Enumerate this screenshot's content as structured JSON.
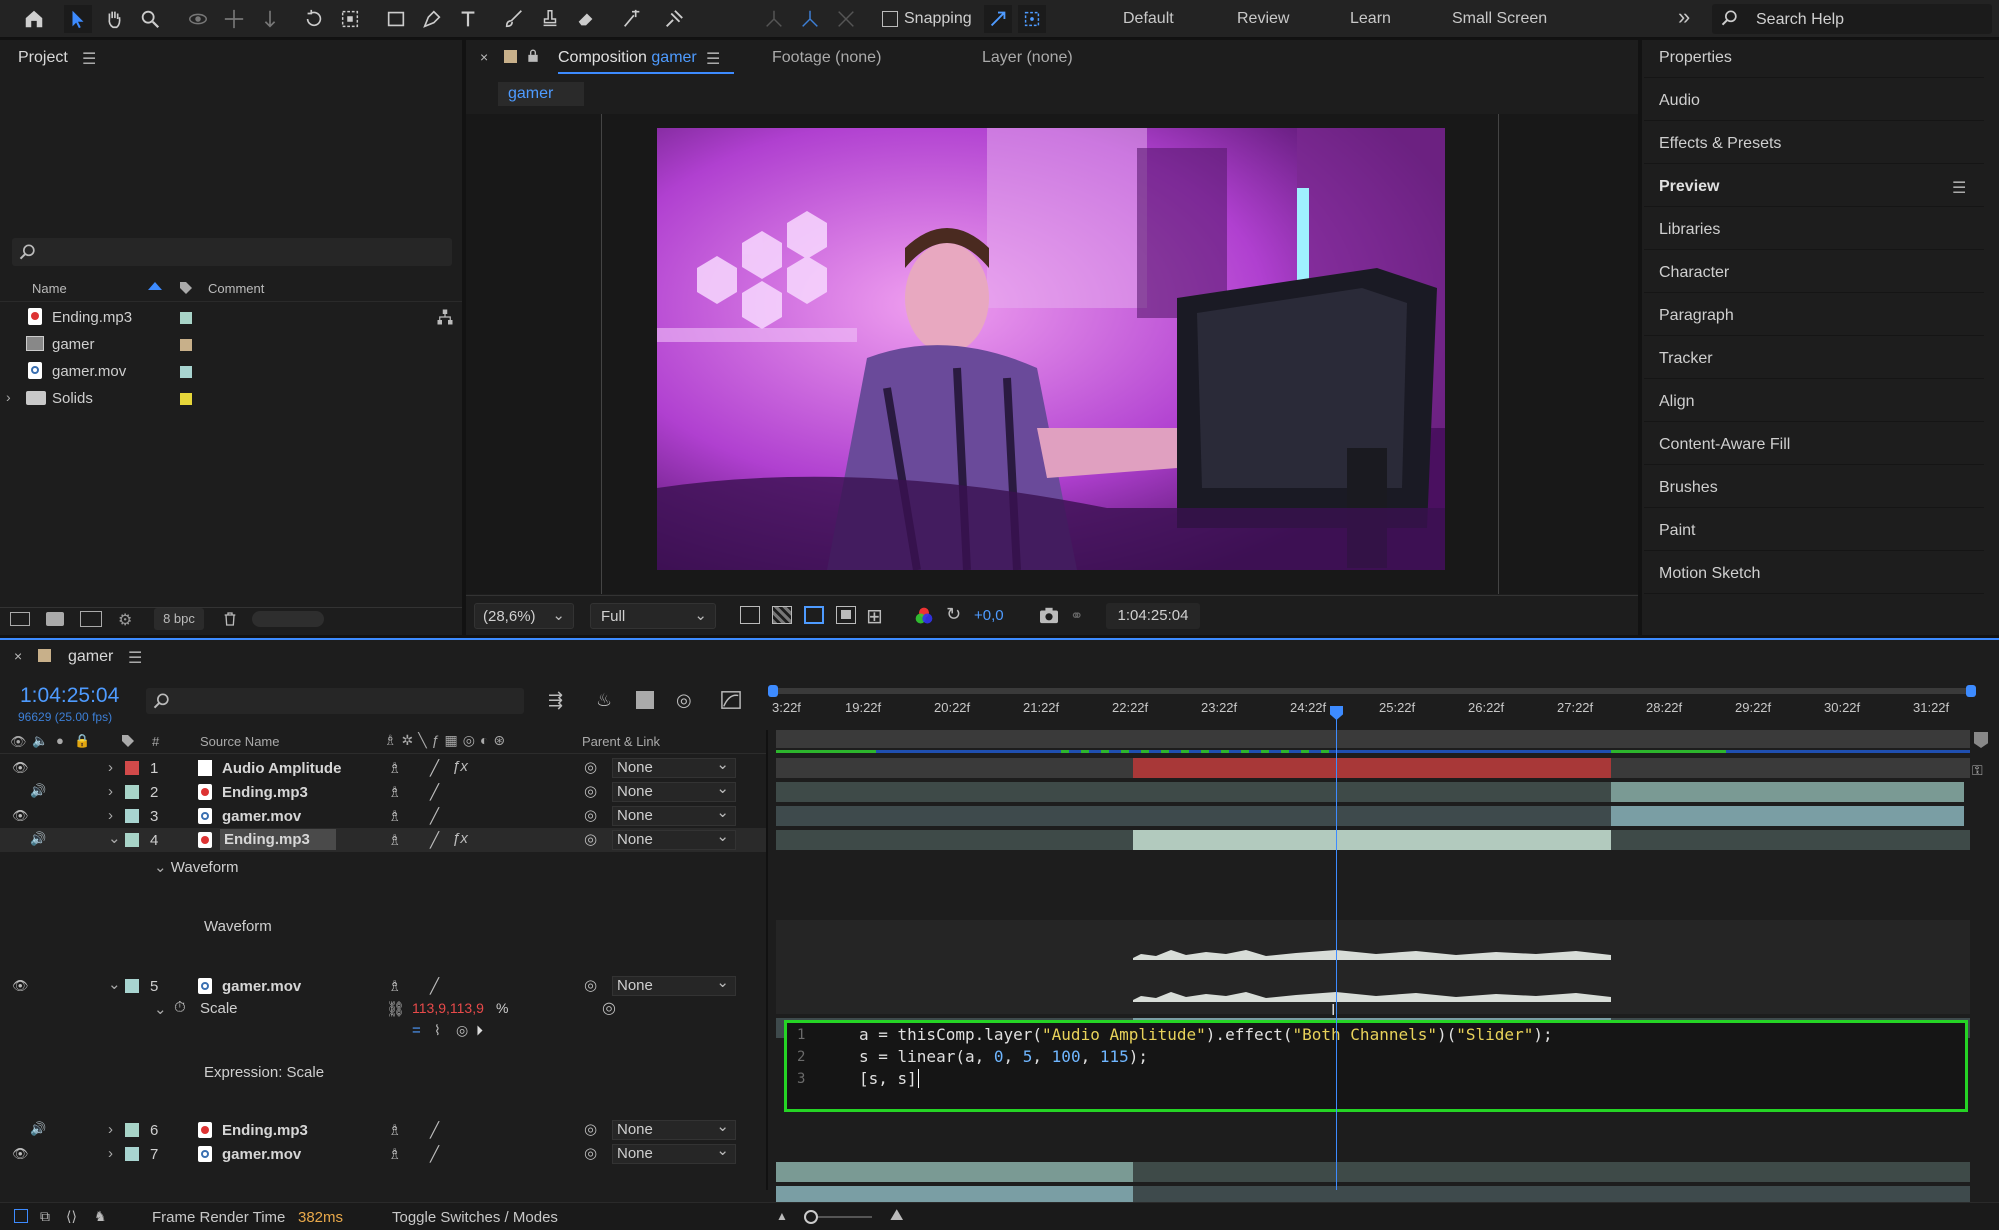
{
  "toolbar": {
    "snapping_label": "Snapping",
    "workspaces": [
      "Default",
      "Review",
      "Learn",
      "Small Screen"
    ],
    "more": "»",
    "search_placeholder": "Search Help"
  },
  "project": {
    "title": "Project",
    "cols": {
      "name": "Name",
      "comment": "Comment"
    },
    "items": [
      {
        "name": "Ending.mp3",
        "color": "#a8d4c8"
      },
      {
        "name": "gamer",
        "color": "#c8b08a"
      },
      {
        "name": "gamer.mov",
        "color": "#a8d4d0"
      },
      {
        "name": "Solids",
        "color": "#e6d63a"
      }
    ],
    "bpc": "8 bpc"
  },
  "viewer": {
    "tabs": {
      "comp_prefix": "Composition",
      "comp_name": "gamer",
      "footage": "Footage (none)",
      "layer": "Layer (none)"
    },
    "subtab": "gamer",
    "zoom": "(28,6%)",
    "resolution": "Full",
    "exposure": "+0,0",
    "timecode": "1:04:25:04"
  },
  "right_panel": {
    "items": [
      "Properties",
      "Audio",
      "Effects & Presets",
      "Preview",
      "Libraries",
      "Character",
      "Paragraph",
      "Tracker",
      "Align",
      "Content-Aware Fill",
      "Brushes",
      "Paint",
      "Motion Sketch"
    ]
  },
  "timeline": {
    "comp_name": "gamer",
    "timecode": "1:04:25:04",
    "fps": "96629 (25.00 fps)",
    "headers": {
      "hash": "#",
      "source": "Source Name",
      "parent": "Parent & Link"
    },
    "ruler": [
      "3:22f",
      "19:22f",
      "20:22f",
      "21:22f",
      "22:22f",
      "23:22f",
      "24:22f",
      "25:22f",
      "26:22f",
      "27:22f",
      "28:22f",
      "29:22f",
      "30:22f",
      "31:22f"
    ],
    "layers": [
      {
        "num": "1",
        "name": "Audio Amplitude",
        "color": "#ffffff",
        "parent": "None"
      },
      {
        "num": "2",
        "name": "Ending.mp3",
        "color": "#a8d4c8",
        "parent": "None"
      },
      {
        "num": "3",
        "name": "gamer.mov",
        "color": "#a8d4d0",
        "parent": "None"
      },
      {
        "num": "4",
        "name": "Ending.mp3",
        "color": "#a8d4c8",
        "parent": "None"
      },
      {
        "num": "5",
        "name": "gamer.mov",
        "color": "#a8d4d0",
        "parent": "None"
      },
      {
        "num": "6",
        "name": "Ending.mp3",
        "color": "#a8d4c8",
        "parent": "None"
      },
      {
        "num": "7",
        "name": "gamer.mov",
        "color": "#a8d4d0",
        "parent": "None"
      }
    ],
    "waveform_group": "Waveform",
    "waveform_prop": "Waveform",
    "scale_label": "Scale",
    "scale_value": "113,9,113,9",
    "scale_unit": "%",
    "expression_label": "Expression: Scale",
    "expression_lines": [
      {
        "n": "1",
        "a": "a = thisComp.layer(",
        "s1": "\"Audio Amplitude\"",
        "b": ").effect(",
        "s2": "\"Both Channels\"",
        "c": ")(",
        "s3": "\"Slider\"",
        "d": ");"
      },
      {
        "n": "2",
        "a": "s = linear(a, ",
        "n1": "0",
        "b": ", ",
        "n2": "5",
        "c": ", ",
        "n3": "100",
        "d": ", ",
        "n4": "115",
        "e": ");"
      },
      {
        "n": "3",
        "a": "[s, s]"
      }
    ],
    "status_label": "Frame Render Time",
    "status_value": "382ms",
    "toggle": "Toggle Switches / Modes"
  }
}
